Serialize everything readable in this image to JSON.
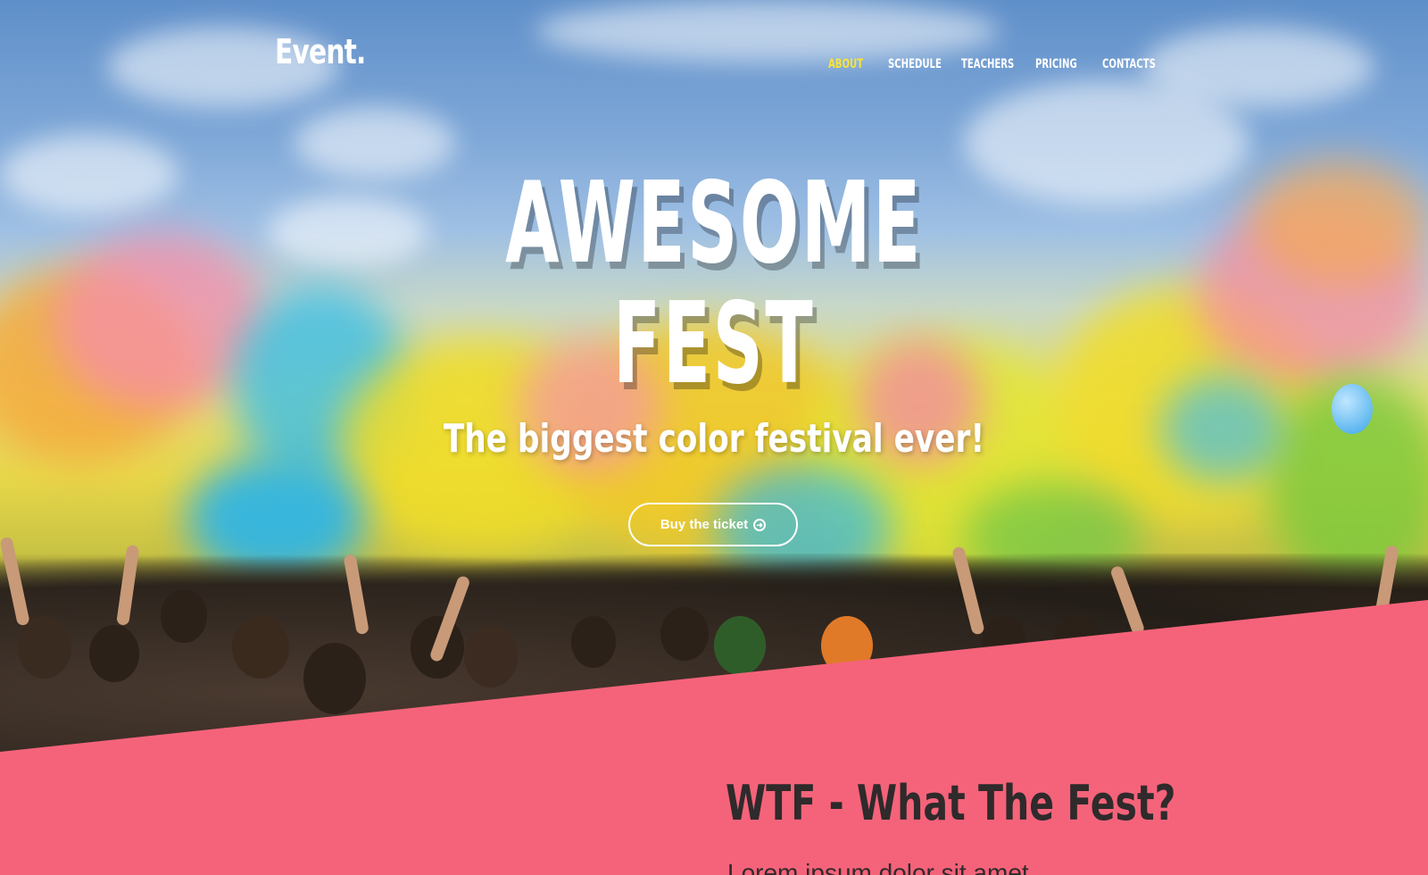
{
  "brand": {
    "logo": "Event."
  },
  "nav": {
    "items": [
      {
        "label": "ABOUT",
        "active": true
      },
      {
        "label": "SCHEDULE",
        "active": false
      },
      {
        "label": "TEACHERS",
        "active": false
      },
      {
        "label": "PRICING",
        "active": false
      },
      {
        "label": "CONTACTS",
        "active": false
      }
    ]
  },
  "hero": {
    "title_line1": "AWESOME",
    "title_line2": "FEST",
    "tagline": "The biggest color festival ever!",
    "cta_label": "Buy the ticket",
    "cta_icon": "arrow-circle-right-icon"
  },
  "about": {
    "title": "WTF - What The Fest?",
    "text": "Lorem ipsum dolor sit amet"
  },
  "colors": {
    "accent_pink": "#f5637a",
    "nav_active": "#f7e43a",
    "heading_dark": "#2f2a2b",
    "white": "#ffffff"
  }
}
